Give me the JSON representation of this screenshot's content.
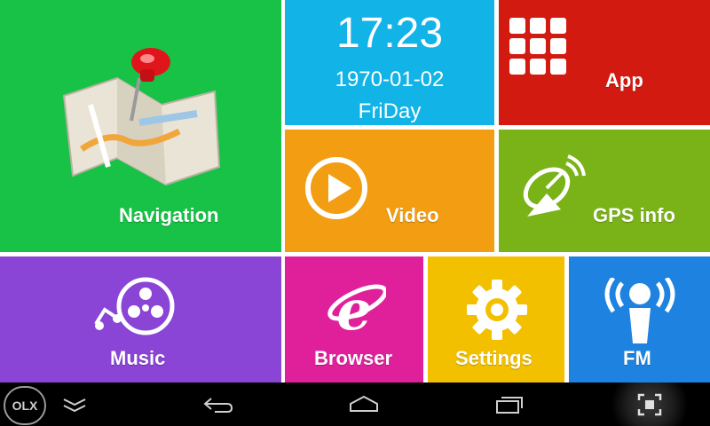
{
  "tiles": {
    "navigation": {
      "label": "Navigation",
      "color": "#17c246",
      "icon": "map-pin-icon"
    },
    "clock": {
      "time": "17:23",
      "date": "1970-01-02",
      "day": "FriDay",
      "color": "#12b3e6"
    },
    "app": {
      "label": "App",
      "color": "#d31a10",
      "icon": "app-grid-icon"
    },
    "video": {
      "label": "Video",
      "color": "#f29d12",
      "icon": "play-icon"
    },
    "gps": {
      "label": "GPS info",
      "color": "#7ab317",
      "icon": "satellite-dish-icon"
    },
    "music": {
      "label": "Music",
      "color": "#8a44d6",
      "icon": "music-reel-icon"
    },
    "browser": {
      "label": "Browser",
      "color": "#e0209a",
      "icon": "browser-e-icon"
    },
    "settings": {
      "label": "Settings",
      "color": "#f3c000",
      "icon": "gear-icon"
    },
    "fm": {
      "label": "FM",
      "color": "#1e83e0",
      "icon": "radio-broadcast-icon"
    }
  },
  "navbar": {
    "watermark": "OLX",
    "buttons": [
      "collapse-icon",
      "back-icon",
      "home-icon",
      "recents-icon",
      "screenshot-icon"
    ]
  }
}
